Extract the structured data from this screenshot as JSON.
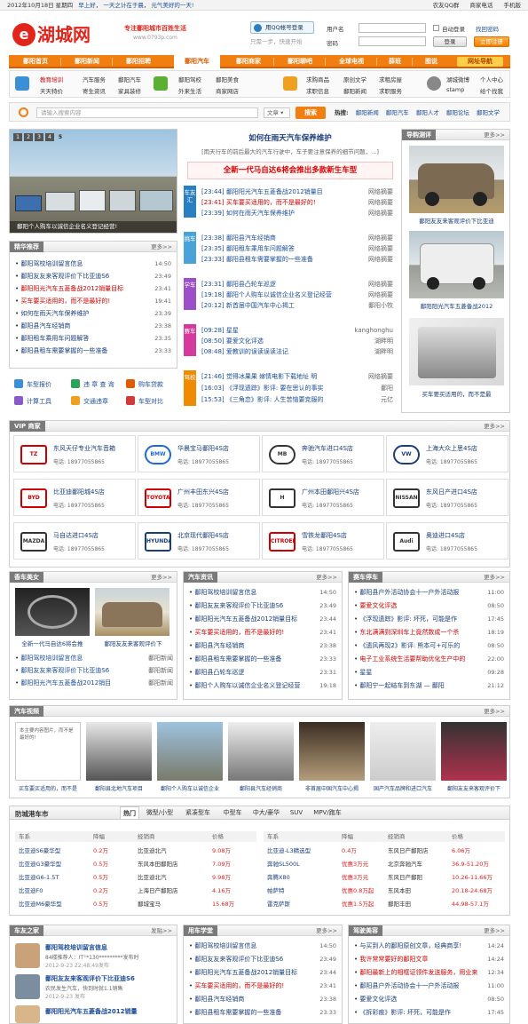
{
  "topbar": {
    "date": "2012年10月18日 星期四",
    "links": [
      "早上好",
      "一天之计在于晨",
      "元气美好的一天!"
    ],
    "right": [
      "农友QQ群",
      "商家电话",
      "手机版"
    ]
  },
  "logo": {
    "mark": "e",
    "text": "湖城网"
  },
  "slogan": {
    "line1": "专注鄱阳城市百姓生活",
    "line2": "www.0793p.com"
  },
  "qq": {
    "button": "用QQ帐号登录",
    "sub": "只需一步，快速开始"
  },
  "login": {
    "user_label": "用户名",
    "pass_label": "密码",
    "auto_login": "自动登录",
    "forgot": "找回密码",
    "login_btn": "登录",
    "register_btn": "立即注册"
  },
  "nav": {
    "items": [
      "鄱阳首页",
      "鄱阳新闻",
      "鄱阳招聘",
      "鄱阳汽车",
      "鄱阳商家",
      "鄱阳聊吧",
      "全球电视",
      "薛班",
      "图说",
      "网址导航"
    ],
    "active": 3
  },
  "subnav": {
    "groups": [
      {
        "a": [
          "教育培训",
          "天天特价"
        ],
        "b": [
          "汽车服务",
          "寄生资讯"
        ],
        "c": [
          "鄱阳汽车",
          "家具装修"
        ]
      },
      {
        "a": [
          "鄱阳驾校",
          "外来生活"
        ],
        "b": [
          "鄱阳美食",
          "商家网店"
        ]
      },
      {
        "a": [
          "求购商品",
          "求职信息"
        ],
        "b": [
          "原创文学",
          "鄱阳新闻"
        ],
        "c": [
          "求租房屋",
          "求职服务"
        ]
      },
      {
        "a": [
          "湖城微博",
          "stamp"
        ],
        "b": [
          "个人中心",
          "给个找我"
        ]
      }
    ]
  },
  "search": {
    "placeholder": "请输入搜索内容",
    "select": "文章",
    "button": "搜索",
    "hot_label": "热搜:",
    "hot": [
      "鄱阳新闻",
      "鄱阳汽车",
      "鄱阳人才",
      "鄱阳论坛",
      "鄱阳文学"
    ]
  },
  "slideshow": {
    "caption": "鄱阳个人购车以诚信企业名义登记经营!",
    "pager": [
      "1",
      "2",
      "3",
      "4",
      "5"
    ]
  },
  "featured": {
    "title": "精华推荐",
    "more": "更多>>",
    "items": [
      {
        "t": "鄱阳驾校培训留言信息",
        "d": "14:50"
      },
      {
        "t": "鄱阳友友来客观评价下比亚迪S6",
        "d": "23:49"
      },
      {
        "t": "鄱阳阳光汽车五菱备战2012销量目标",
        "d": "23:41"
      },
      {
        "t": "买车要买适用的，而不是最好的!",
        "d": "19:41"
      },
      {
        "t": "如何在雨天汽车保养维护",
        "d": "23:39"
      },
      {
        "t": "鄱阳县汽车经销商",
        "d": "23:38"
      },
      {
        "t": "鄱阳租车乘用车问题解答",
        "d": "23:35"
      },
      {
        "t": "鄱阳县租车需要掌握的一些准备",
        "d": "23:33"
      }
    ]
  },
  "tools": [
    [
      "车型报价",
      "违 章 查 询",
      "购车贷款"
    ],
    [
      "计算工具",
      "交通违章",
      "车型对比"
    ]
  ],
  "headline": {
    "title": "如何在雨天汽车保养维护",
    "summary": "[雨天行车的前后最大的汽车行驶中，车子要注意保养的细节问题，...]",
    "feature": "全新一代马自达6将会推出多款新生车型"
  },
  "news_groups": [
    {
      "tag": "车友汇",
      "color": "#2a7fc2",
      "rows": [
        {
          "t": "[23:44] 鄱阳阳光汽车五菱备战2012销量目",
          "s": "网络摘要"
        },
        {
          "t": "[23:41] 买车要买适用的，而不是最好的!",
          "s": "网络摘要"
        },
        {
          "t": "[23:39] 如何在雨天汽车保养维护",
          "s": "网络摘要"
        }
      ]
    },
    {
      "tag": "挑车",
      "color": "#4aa3d8",
      "rows": [
        {
          "t": "[23:38] 鄱阳县汽车经销商",
          "s": "网络摘要"
        },
        {
          "t": "[23:35] 鄱阳租车乘用车问题解答",
          "s": "网络摘要"
        },
        {
          "t": "[23:33] 鄱阳县租车需要掌握的一些准备",
          "s": "网络摘要"
        }
      ]
    },
    {
      "tag": "学车",
      "color": "#9c4fc7",
      "rows": [
        {
          "t": "[23:31] 鄱阳县凸轮车巡逻",
          "s": "网络摘要"
        },
        {
          "t": "[19:18] 鄱阳个人购车以诚信企业名义登记经营",
          "s": "网络摘要"
        },
        {
          "t": "[20:12] 新首届中国汽车中心揭工",
          "s": "鄱阳小牧"
        }
      ]
    },
    {
      "tag": "赛车",
      "color": "#d6399d",
      "rows": [
        {
          "t": "[09:28] 星星",
          "s": "kanghonghu"
        },
        {
          "t": "[08:50] 要爱文化评选",
          "s": "湖畔明"
        },
        {
          "t": "[08:48] 爱教训的误读误读法记",
          "s": "湖畔明"
        }
      ]
    },
    {
      "tag": "驾校",
      "color": "#f08a00",
      "rows": [
        {
          "t": "[21:46] 觉得冰果果 嫁情电影下载地址 明",
          "s": "网络摘要"
        },
        {
          "t": "[16:03] 《浮现遗踪》影评: 要在思认的事实",
          "s": "鄱阳"
        },
        {
          "t": "[15:53] 《三角恋》影评: 人生苦恼要克服的",
          "s": "元亿"
        }
      ]
    }
  ],
  "photo_news": {
    "title": "导购测评",
    "more": "更多>>",
    "captions": [
      "鄱阳友友来客观评价下比亚迪",
      "鄱阳阳光汽车五菱备战2012",
      "买车要买适用的，而不是最"
    ]
  },
  "vip": {
    "title": "VIP 商家",
    "more": "更多>>",
    "dealers": [
      {
        "n": "东风天仔专业汽车音箱",
        "p": "电话: 18977055865",
        "logo": "TZ"
      },
      {
        "n": "华晨宝马鄱阳4S店",
        "p": "电话: 18977055865",
        "logo": "BMW"
      },
      {
        "n": "奔驰汽车进口4S店",
        "p": "电话: 18977055865",
        "logo": "MB"
      },
      {
        "n": "上海大众上思4S店",
        "p": "电话: 18977055865",
        "logo": "VW"
      },
      {
        "n": "比亚迪鄱阳城4S店",
        "p": "电话: 18977055865",
        "logo": "BYD"
      },
      {
        "n": "广州丰田东兴4S店",
        "p": "电话: 18977055865",
        "logo": "TOYOTA"
      },
      {
        "n": "广州本田鄱阳兴4S店",
        "p": "电话: 18977055865",
        "logo": "H"
      },
      {
        "n": "东风日产进口4S店",
        "p": "电话: 18977055865",
        "logo": "NISSAN"
      },
      {
        "n": "马自达进口4S店",
        "p": "电话: 18977055865",
        "logo": "MAZDA"
      },
      {
        "n": "北京现代鄱阳4S店",
        "p": "电话: 18977055865",
        "logo": "HYUNDAI"
      },
      {
        "n": "雪铁龙鄱阳4S店",
        "p": "电话: 18977055865",
        "logo": "CITROEN"
      },
      {
        "n": "奥迪进口4S店",
        "p": "电话: 18977055865",
        "logo": "Audi"
      }
    ]
  },
  "car_beauty": {
    "title": "香车美女",
    "more": "更多>>",
    "captions": [
      "全新一代马自达6将会推",
      "鄱阳友友来客观评价下"
    ],
    "rows": [
      {
        "t": "鄱阳驾校培训留言信息",
        "s": "鄱阳新闻"
      },
      {
        "t": "鄱阳友友来客观评价下比亚迪S6",
        "s": "鄱阳新闻"
      },
      {
        "t": "鄱阳阳光汽车五菱备战2012销目",
        "s": "鄱阳新闻"
      }
    ]
  },
  "car_info": {
    "title": "汽车资讯",
    "more": "更多>>",
    "rows": [
      {
        "t": "鄱阳驾校培训留言信息",
        "d": "14:50"
      },
      {
        "t": "鄱阳友友来客观评价下比亚迪S6",
        "d": "23:49"
      },
      {
        "t": "鄱阳阳光汽车五菱备战2012销量目标",
        "d": "23:44"
      },
      {
        "t": "买车要买适用的，而不是最好的!",
        "d": "23:41"
      },
      {
        "t": "鄱阳县汽车经销商",
        "d": "23:38"
      },
      {
        "t": "鄱阳县租车需要掌握的一些准备",
        "d": "23:33"
      },
      {
        "t": "鄱阳县凸轮车巡逻",
        "d": "23:31"
      },
      {
        "t": "鄱阳个人购车以诚信企业名义登记经营",
        "d": "19:18"
      }
    ]
  },
  "fan_club": {
    "title": "赛车停车",
    "more": "更多>>",
    "rows": [
      {
        "t": "鄱阳县户外活动协会十一户外活动报",
        "d": "11:00"
      },
      {
        "t": "要爱文化评选",
        "d": "08:50"
      },
      {
        "t": "《浮现遗踪》影评: 坏死，可能是作",
        "d": "17:45"
      },
      {
        "t": "东北满满到深圳车上竟然数成一个杀",
        "d": "18:19"
      },
      {
        "t": "《遗风再现2》影评: 熊本可+可乐的",
        "d": "08:50"
      },
      {
        "t": "电子工业系统生活要帮助优化生产中的",
        "d": "22:00"
      },
      {
        "t": "星星",
        "d": "09:28"
      },
      {
        "t": "鄱阳宁一起结车到东湖 — 鄱阳",
        "d": "21:12"
      }
    ]
  },
  "video": {
    "title": "汽车视频",
    "more": "更多>>",
    "broken": "本主要内容图片，而不是最好的!",
    "captions": [
      "买车要买适用的，而不是",
      "鄱阳县北地汽车项目",
      "鄱阳个人购车以诚信企业",
      "鄱阳县汽车经销商",
      "非首届中国汽车中心揭",
      "国产汽车品牌和进口汽车",
      "鄱阳友友来客观评价下"
    ]
  },
  "price_market": {
    "title": "防城港车市",
    "tabs": [
      "热门",
      "微型/小型",
      "紧凑型车",
      "中型车",
      "中大/豪华",
      "SUV",
      "MPV/跑车"
    ],
    "active_tab": 0,
    "left_head": [
      "车系",
      "降幅",
      "经销商",
      "价格"
    ],
    "left": [
      [
        "比亚迪S6豪华型",
        "0.2万",
        "比亚迪北汽",
        "9.08万"
      ],
      [
        "比亚迪G3豪华型",
        "0.5万",
        "东风本田鄱阳店",
        "7.09万"
      ],
      [
        "比亚迪G6-1.5T",
        "0.5万",
        "比亚迪北汽",
        "9.98万"
      ],
      [
        "比亚迪F0",
        "0.2万",
        "上海日产鄱阳店",
        "4.16万"
      ],
      [
        "比亚迪M6豪华型",
        "0.5万",
        "鄱城宝马",
        "15.68万"
      ]
    ],
    "right_head": [
      "车系",
      "降幅",
      "经销商",
      "价格"
    ],
    "right": [
      [
        "比亚迪-L3精选型",
        "0.4万",
        "东风日产鄱阳店",
        "6.06万"
      ],
      [
        "奔驰SL500L",
        "优惠3万元",
        "北京奔驰汽车",
        "36.9-51.20万"
      ],
      [
        "奔腾X80",
        "优惠3万元",
        "东风日产鄱阳",
        "10.26-11.66万"
      ],
      [
        "帕萨特",
        "优惠0.8万起",
        "东风本田",
        "20.18-24.68万"
      ],
      [
        "雷克萨斯",
        "优惠1.5万起",
        "鄱阳丰田",
        "44.98-57.1万"
      ]
    ]
  },
  "friends": {
    "title": "车友之家",
    "more": "发贴>>",
    "items": [
      {
        "t": "鄱阳驾校培训留言信息",
        "a": "84楼推荐人：ΙΤ°*130*********发布时",
        "d": "2012-9-23 22:48:49发布"
      },
      {
        "t": "鄱阳友友来客观评价下比亚迪S6",
        "a": "农民发生汽车，快到时就1.1销售",
        "d": "2012-9-23 发布"
      },
      {
        "t": "鄱阳阳光汽车五菱备战2012销量",
        "a": "",
        "d": ""
      }
    ]
  },
  "car_learn": {
    "title": "用车学堂",
    "more": "更多>>",
    "rows": [
      {
        "t": "鄱阳驾校培训留言信息",
        "d": "14:50"
      },
      {
        "t": "鄱阳友友来客观评价下比亚迪S6",
        "d": "23:49"
      },
      {
        "t": "鄱阳阳光汽车五菱备战2012销量目标",
        "d": "23:44"
      },
      {
        "t": "买车要买适用的，而不是最好的!",
        "d": "23:41"
      },
      {
        "t": "鄱阳县汽车经销商",
        "d": "23:38"
      },
      {
        "t": "鄱阳县租车需要掌握的一些准备",
        "d": "23:33"
      }
    ]
  },
  "car_tips": {
    "title": "驾驶美容",
    "more": "更多>>",
    "rows": [
      {
        "t": "与买到人的鄱阳原创文章，经典商享!",
        "d": "14:24"
      },
      {
        "t": "我许常常要好的鄱阳文章",
        "d": "14:24"
      },
      {
        "t": "鄱阳最新上的相框证领件发送服务，用业来",
        "d": "12:34"
      },
      {
        "t": "鄱阳县户外活动协会十一户外活动报",
        "d": "11:00"
      },
      {
        "t": "要爱文化评选",
        "d": "08:50"
      },
      {
        "t": "《拆彩痕》影评: 坏死，可能是作",
        "d": "17:45"
      }
    ]
  }
}
